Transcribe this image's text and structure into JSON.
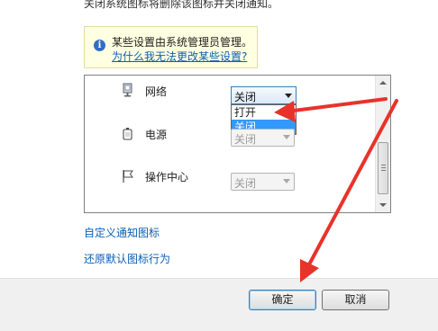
{
  "header": {
    "truncated_text": "关闭系统图标将删除该图标并关闭通知。"
  },
  "info": {
    "icon": "info-icon",
    "title": "某些设置由系统管理员管理。",
    "link": "为什么我无法更改某些设置?"
  },
  "rows": [
    {
      "icon": "network-icon",
      "label": "网络",
      "value": "关闭"
    },
    {
      "icon": "power-icon",
      "label": "电源",
      "value": "关闭"
    },
    {
      "icon": "action-center-flag-icon",
      "label": "操作中心",
      "value": "关闭"
    }
  ],
  "dropdown": {
    "options": [
      "打开",
      "关闭"
    ],
    "selected": "关闭"
  },
  "links": {
    "customize": "自定义通知图标",
    "restore": "还原默认图标行为"
  },
  "buttons": {
    "ok": "确定",
    "cancel": "取消"
  },
  "annotation": {
    "arrow_color": "#e8332a"
  }
}
